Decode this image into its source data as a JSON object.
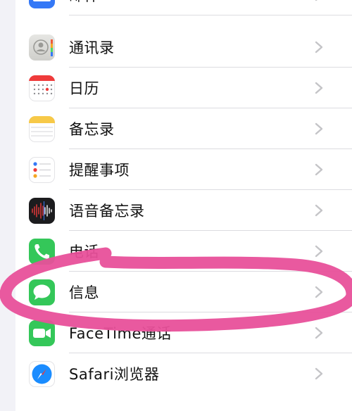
{
  "settings_list": {
    "items": [
      {
        "label": "邮件",
        "icon": "mail-icon",
        "color": "#3478f6"
      },
      {
        "label": "通讯录",
        "icon": "contacts-icon",
        "color": "#d8d8d5"
      },
      {
        "label": "日历",
        "icon": "calendar-icon",
        "color": "#ffffff"
      },
      {
        "label": "备忘录",
        "icon": "notes-icon",
        "color": "#f7c948"
      },
      {
        "label": "提醒事项",
        "icon": "reminders-icon",
        "color": "#ffffff"
      },
      {
        "label": "语音备忘录",
        "icon": "voice-memos-icon",
        "color": "#1c1c1e"
      },
      {
        "label": "电话",
        "icon": "phone-icon",
        "color": "#34c759"
      },
      {
        "label": "信息",
        "icon": "messages-icon",
        "color": "#34c759"
      },
      {
        "label": "FaceTime通话",
        "icon": "facetime-icon",
        "color": "#34c759"
      },
      {
        "label": "Safari浏览器",
        "icon": "safari-icon",
        "color": "#1a8cff"
      }
    ]
  },
  "annotation": {
    "color": "#e8509a"
  }
}
